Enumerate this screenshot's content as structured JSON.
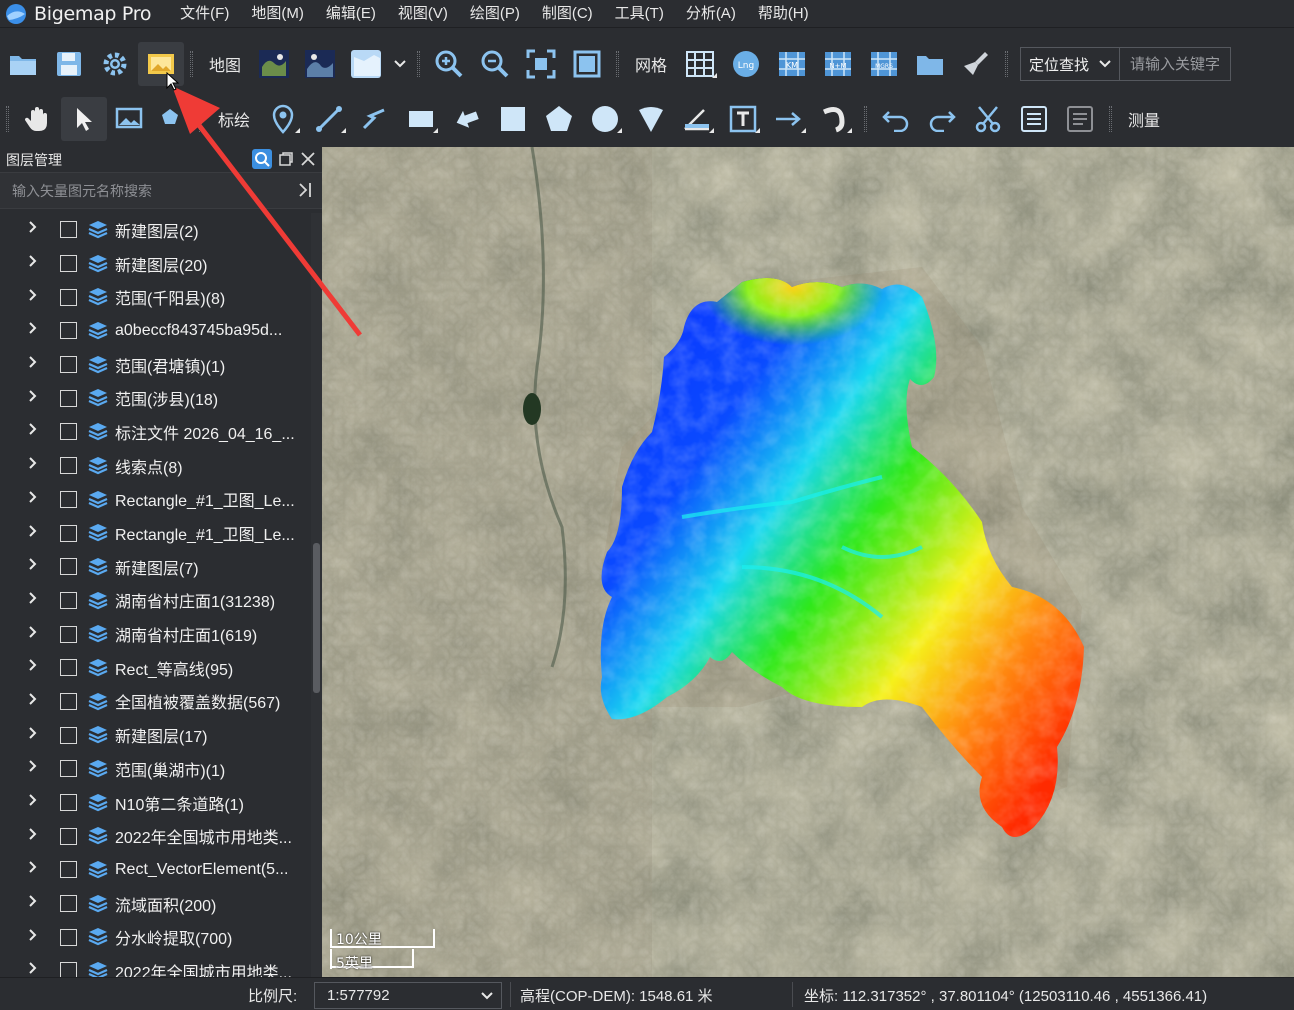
{
  "app": {
    "title": "Bigemap Pro"
  },
  "menu": [
    "文件(F)",
    "地图(M)",
    "编辑(E)",
    "视图(V)",
    "绘图(P)",
    "制图(C)",
    "工具(T)",
    "分析(A)",
    "帮助(H)"
  ],
  "toolbar1": {
    "icons": [
      "open-folder-icon",
      "save-icon",
      "settings-gear-icon",
      "import-image-icon"
    ],
    "map_label": "地图",
    "grid_label": "网格",
    "locate_label": "定位查找",
    "search_placeholder": "请输入关键字"
  },
  "toolbar2": {
    "annotate_label": "标绘",
    "measure_label": "测量"
  },
  "layer_panel": {
    "title": "图层管理",
    "search_placeholder": "输入矢量图元名称搜索",
    "layers": [
      "新建图层(2)",
      "新建图层(20)",
      "范围(千阳县)(8)",
      "a0beccf843745ba95d...",
      "范围(君塘镇)(1)",
      "范围(涉县)(18)",
      "标注文件 2026_04_16_...",
      "线索点(8)",
      "Rectangle_#1_卫图_Le...",
      "Rectangle_#1_卫图_Le...",
      "新建图层(7)",
      "湖南省村庄面1(31238)",
      "湖南省村庄面1(619)",
      "Rect_等高线(95)",
      "全国植被覆盖数据(567)",
      "新建图层(17)",
      "范围(巢湖市)(1)",
      "N10第二条道路(1)",
      "2022年全国城市用地类...",
      "Rect_VectorElement(5...",
      "流域面积(200)",
      "分水岭提取(700)",
      "2022年全国城市用地类..."
    ]
  },
  "map": {
    "scale_km": "10公里",
    "scale_mi": "5英里",
    "colors": {
      "low": "#0a2bff",
      "mid": "#19f0f0",
      "green": "#2ee81a",
      "yellow": "#f6f01a",
      "high": "#ff2a00"
    }
  },
  "status": {
    "scale_label": "比例尺:",
    "scale_value": "1:577792",
    "elevation": "高程(COP-DEM): 1548.61 米",
    "coords": "坐标: 112.317352° , 37.801104°   (12503110.46 , 4551366.41)"
  }
}
